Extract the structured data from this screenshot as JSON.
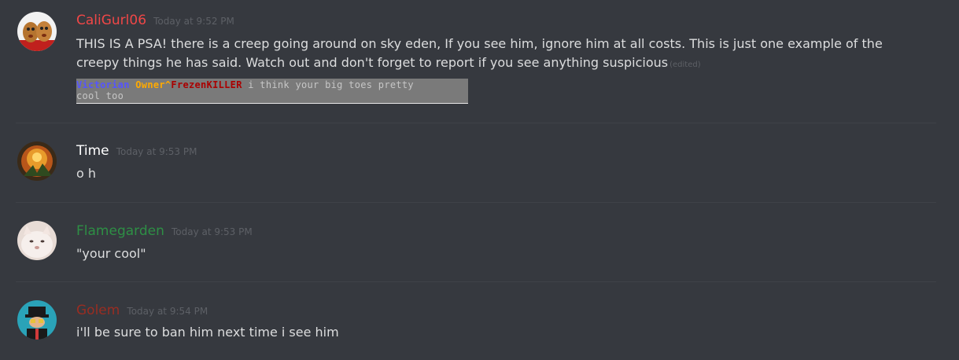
{
  "messages": [
    {
      "username": "CaliGurl06",
      "name_color": "#f04747",
      "timestamp": "Today at 9:52 PM",
      "text": "THIS IS A PSA! there is a creep going around on sky eden, If you see him, ignore him at all costs. This is just one example of the creepy things he has said. Watch out and don't forget to report if you see anything suspicious",
      "edited_label": "(edited)",
      "attachment": {
        "rank": "Victorian",
        "owner": "Owner",
        "sep": "^",
        "player": "FrezenKILLER",
        "chat_line1": "i think your big toes pretty",
        "chat_line2": "cool too"
      }
    },
    {
      "username": "Time",
      "name_color": "#ffffff",
      "timestamp": "Today at 9:53 PM",
      "text": "o h"
    },
    {
      "username": "Flamegarden",
      "name_color": "#2e8f45",
      "timestamp": "Today at 9:53 PM",
      "text": "\"your cool\""
    },
    {
      "username": "Golem",
      "name_color": "#992d22",
      "timestamp": "Today at 9:54 PM",
      "text": "i'll be sure to ban him next time i see him"
    }
  ]
}
